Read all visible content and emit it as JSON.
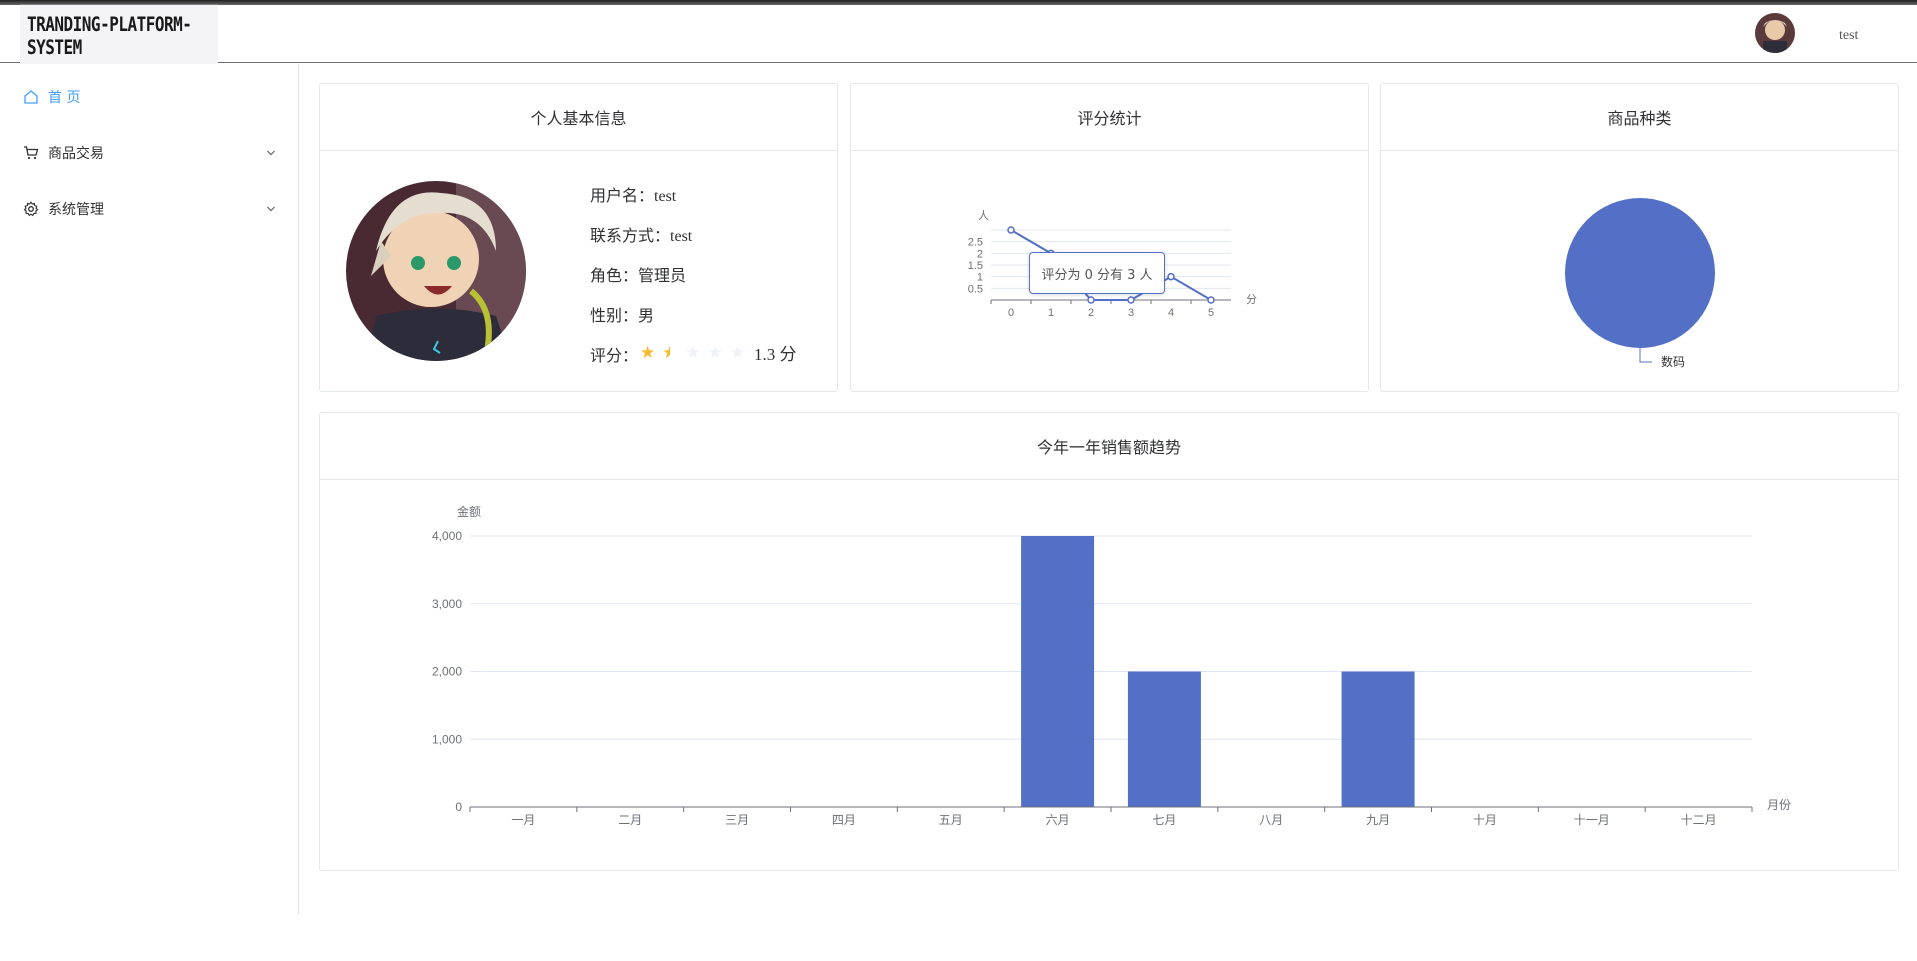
{
  "app": {
    "logo_text": "TRANDING-PLATFORM-SYSTEM",
    "user_name": "test"
  },
  "sidebar": {
    "items": [
      {
        "label": "首 页",
        "icon": "home-icon",
        "active": true
      },
      {
        "label": "商品交易",
        "icon": "cart-icon",
        "active": false
      },
      {
        "label": "系统管理",
        "icon": "gear-icon",
        "active": false
      }
    ]
  },
  "profile_card": {
    "title": "个人基本信息",
    "username_label": "用户名：",
    "username": "test",
    "contact_label": "联系方式：",
    "contact": "test",
    "role_label": "角色：",
    "role": "管理员",
    "gender_label": "性别：",
    "gender": "男",
    "score_label": "评分：",
    "score_value": 1.3,
    "score_text": "1.3 分",
    "score_max": 5
  },
  "rating_card": {
    "title": "评分统计",
    "tooltip": "评分为 0 分有 3 人",
    "chart_data": {
      "type": "line",
      "x": [
        0,
        1,
        2,
        3,
        4,
        5
      ],
      "values": [
        3,
        2,
        0,
        0,
        1,
        0
      ],
      "xlabel": "分",
      "ylabel": "人",
      "y_ticks": [
        "0.5",
        "1",
        "1.5",
        "2",
        "2.5"
      ],
      "x_ticks": [
        "0",
        "1",
        "2",
        "3",
        "4",
        "5"
      ],
      "ylim": [
        0,
        3
      ],
      "color": "#5470c6"
    }
  },
  "category_card": {
    "title": "商品种类",
    "chart_data": {
      "type": "pie",
      "categories": [
        "数码"
      ],
      "values": [
        1
      ],
      "color": "#5470c6"
    }
  },
  "sales_card": {
    "title": "今年一年销售额趋势",
    "chart_data": {
      "type": "bar",
      "categories": [
        "一月",
        "二月",
        "三月",
        "四月",
        "五月",
        "六月",
        "七月",
        "八月",
        "九月",
        "十月",
        "十一月",
        "十二月"
      ],
      "values": [
        0,
        0,
        0,
        0,
        0,
        4000,
        2000,
        0,
        2000,
        0,
        0,
        0
      ],
      "ylabel": "金额",
      "xlabel": "月份",
      "y_ticks": [
        "0",
        "1,000",
        "2,000",
        "3,000",
        "4,000"
      ],
      "ylim": [
        0,
        4000
      ],
      "color": "#5470c6"
    }
  }
}
